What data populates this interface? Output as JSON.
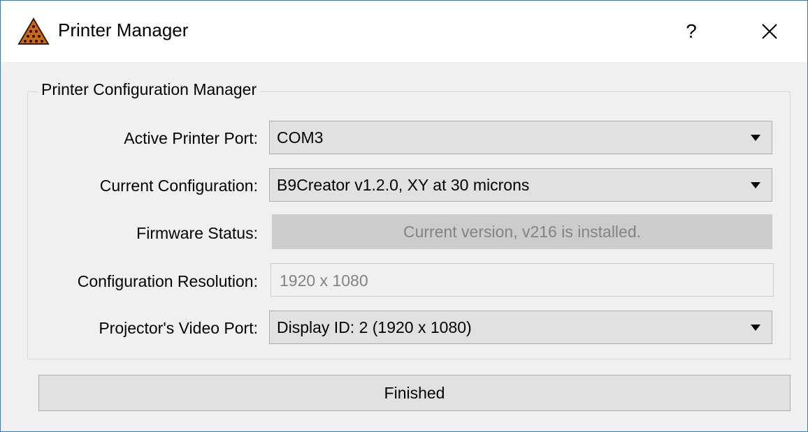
{
  "window": {
    "title": "Printer Manager",
    "help_label": "?",
    "close_label": "✕"
  },
  "group": {
    "title": "Printer Configuration Manager"
  },
  "fields": {
    "active_port": {
      "label": "Active Printer Port:",
      "value": "COM3"
    },
    "current_config": {
      "label": "Current Configuration:",
      "value": "B9Creator v1.2.0, XY at 30 microns"
    },
    "firmware_status": {
      "label": "Firmware Status:",
      "value": "Current version, v216 is installed."
    },
    "config_resolution": {
      "label": "Configuration Resolution:",
      "value": "1920 x 1080"
    },
    "video_port": {
      "label": "Projector's Video Port:",
      "value": "Display ID: 2 (1920 x 1080)"
    }
  },
  "footer": {
    "finished_label": "Finished"
  },
  "colors": {
    "window_border": "#2b7bd1",
    "background": "#f0f0f0",
    "button_face": "#e1e1e1",
    "disabled_text": "#838383"
  },
  "icons": {
    "app": "b9-triangle-icon",
    "close": "close-icon",
    "dropdown": "chevron-down-icon"
  }
}
